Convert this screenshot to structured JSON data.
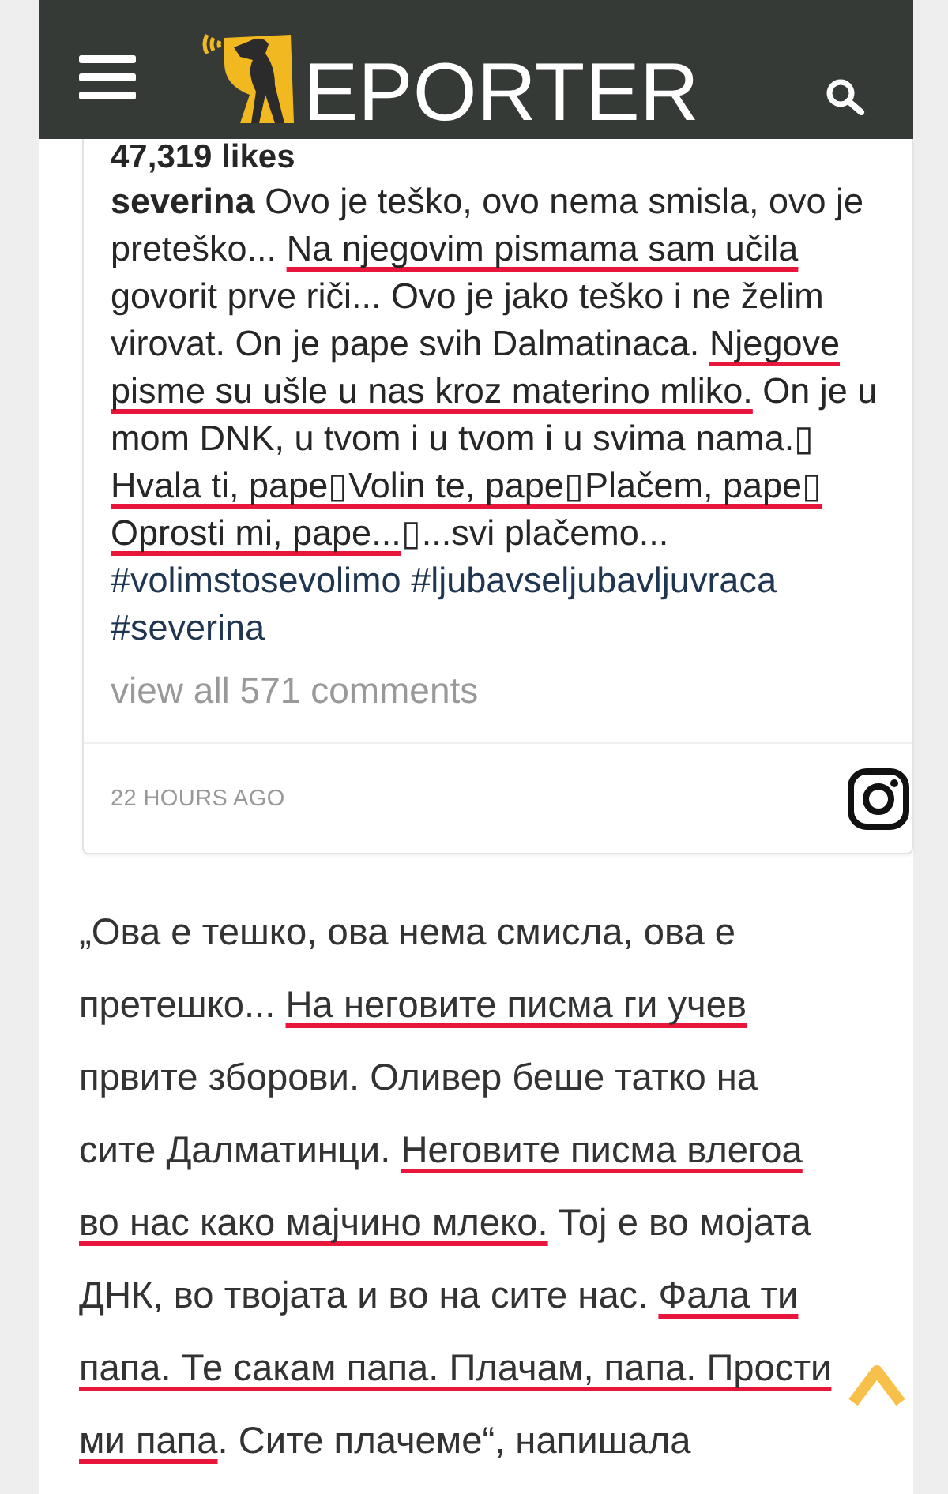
{
  "header": {
    "logo_text": "EPORTER"
  },
  "post": {
    "likes": "47,319 likes",
    "caption": {
      "username": "severina",
      "segments": [
        {
          "text": "Ovo je teško, ovo nema smisla, ovo je preteško... ",
          "underlined": false
        },
        {
          "text": "Na njegovim pismama sam učila",
          "underlined": true
        },
        {
          "text": " govorit prve riči... Ovo je jako teško i ne želim virovat. On je pape svih Dalmatinaca. ",
          "underlined": false
        },
        {
          "text": "Njegove pisme su ušle u nas kroz materino mliko.",
          "underlined": true
        },
        {
          "text": " On je u mom DNK, u tvom i u tvom i u svima nama.▯ ",
          "underlined": false
        },
        {
          "text": "Hvala ti, pape▯Volin te, pape▯Plačem, pape▯ Oprosti mi, pape...",
          "underlined": true
        },
        {
          "text": "▯...svi plačemo...",
          "underlined": false
        }
      ]
    },
    "hashtags": [
      "#volimstosevolimo",
      "#ljubavseljubavljuvraca",
      "#severina"
    ],
    "comments_link": "view all 571 comments",
    "timestamp": "22 HOURS AGO"
  },
  "article": {
    "segments": [
      {
        "text": "„Ова е тешко, ова нема смисла, ова е претешко... ",
        "underlined": false
      },
      {
        "text": "На неговите писма ги учев",
        "underlined": true
      },
      {
        "text": " првите зборови. Оливер беше татко на сите Далматинци. ",
        "underlined": false
      },
      {
        "text": "Неговите писма влегоа во нас како мајчино млеко.",
        "underlined": true
      },
      {
        "text": " Тој е во мојата ДНК, во твојата и во на сите нас. ",
        "underlined": false
      },
      {
        "text": "Фала ти папа. Те сакам папа. Плачам, папа. Прости ми папа",
        "underlined": true
      },
      {
        "text": ". Сите плачеме“, напишала",
        "underlined": false
      }
    ]
  }
}
